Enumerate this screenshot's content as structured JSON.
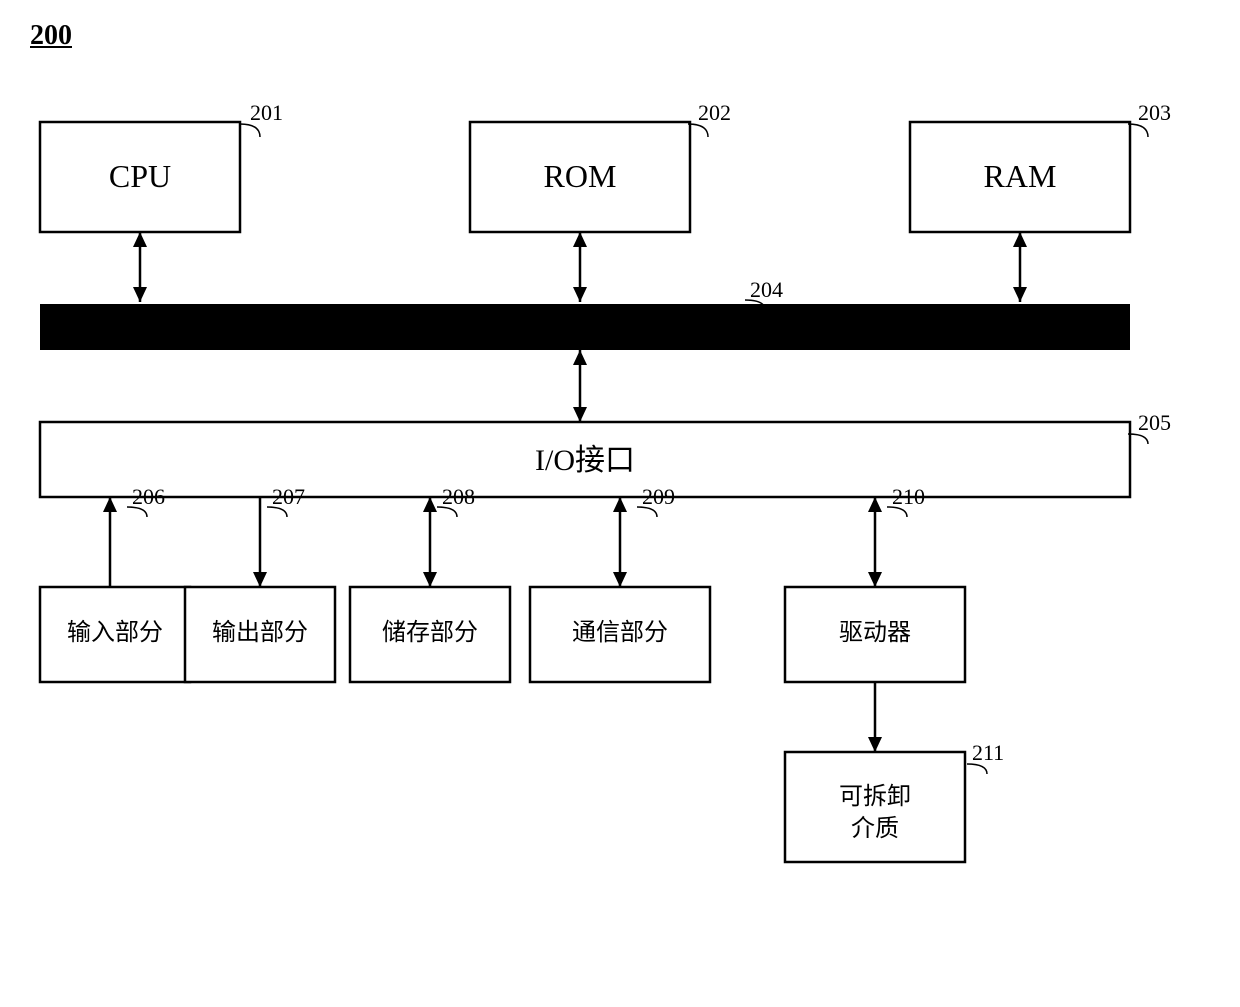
{
  "figure": {
    "number": "200",
    "components": {
      "cpu": {
        "label": "CPU",
        "ref": "201"
      },
      "rom": {
        "label": "ROM",
        "ref": "202"
      },
      "ram": {
        "label": "RAM",
        "ref": "203"
      },
      "bus": {
        "ref": "204"
      },
      "io": {
        "label": "I/O接口",
        "ref": "205"
      },
      "input": {
        "label": "输入部分",
        "ref": "206"
      },
      "output": {
        "label": "输出部分",
        "ref": "207"
      },
      "storage": {
        "label": "储存部分",
        "ref": "208"
      },
      "comm": {
        "label": "通信部分",
        "ref": "209"
      },
      "driver": {
        "label": "驱动器",
        "ref": "210"
      },
      "removable": {
        "label": "可拆卸\n介质",
        "ref": "211"
      }
    }
  }
}
